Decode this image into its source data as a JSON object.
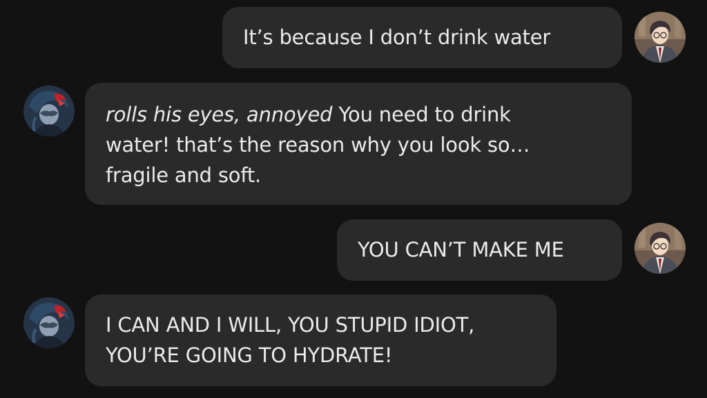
{
  "conversation": {
    "messages": [
      {
        "sender": "user",
        "avatar": "user-avatar-icon",
        "text": "It’s because I don’t drink water"
      },
      {
        "sender": "character",
        "avatar": "character-avatar-icon",
        "action": "rolls his eyes, annoyed",
        "text": "You need to drink\nwater! that’s the reason why you look so…\nfragile and soft."
      },
      {
        "sender": "user",
        "avatar": "user-avatar-icon",
        "text": "YOU CAN’T MAKE ME"
      },
      {
        "sender": "character",
        "avatar": "character-avatar-icon",
        "text": "I CAN AND I WILL, YOU STUPID IDIOT,\nYOU’RE GOING TO HYDRATE!"
      }
    ]
  },
  "colors": {
    "background": "#121212",
    "bubble": "#2a2a2a",
    "text": "#ececec"
  }
}
